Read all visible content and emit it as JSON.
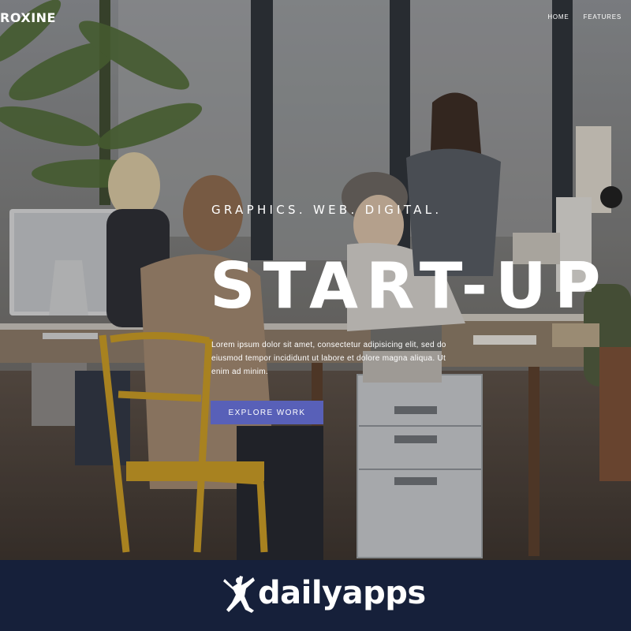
{
  "header": {
    "logo_text": "ROXINE",
    "nav": [
      {
        "label": "HOME"
      },
      {
        "label": "FEATURES"
      }
    ]
  },
  "hero": {
    "tagline": "GRAPHICS. WEB. DIGITAL.",
    "headline": "START-UP",
    "body": "Lorem ipsum dolor sit amet, consectetur adipisicing elit, sed do eiusmod tempor incididunt ut labore et dolore magna aliqua. Ut enim ad minim.",
    "cta_label": "EXPLORE WORK",
    "background_image": "open-plan office with people working at desks"
  },
  "footer_brand": {
    "wordmark": "dailyapps",
    "mascot_icon": "dancing-figure-icon"
  },
  "colors": {
    "accent": "#5860b8",
    "brand_bar": "#16203a",
    "text": "#ffffff"
  }
}
